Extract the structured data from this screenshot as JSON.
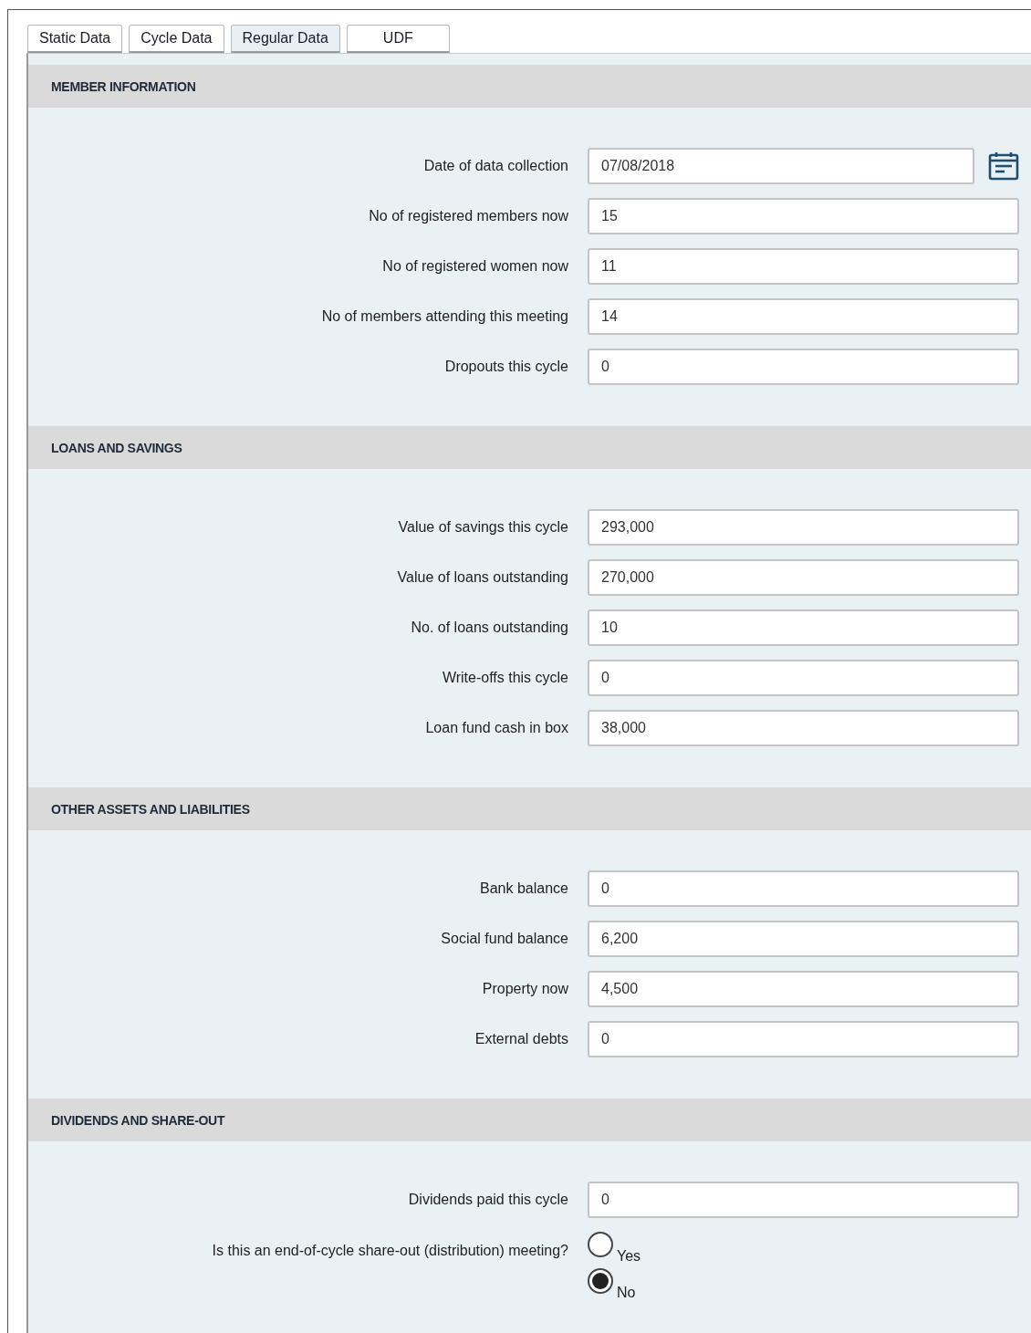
{
  "tabs": [
    {
      "label": "Static Data",
      "selected": false
    },
    {
      "label": "Cycle Data",
      "selected": false
    },
    {
      "label": "Regular Data",
      "selected": true
    },
    {
      "label": "UDF",
      "selected": false
    }
  ],
  "sections": [
    {
      "title": "MEMBER INFORMATION",
      "fields": [
        {
          "kind": "date",
          "label": "Date of data collection",
          "value": "07/08/2018"
        },
        {
          "kind": "text",
          "label": "No of registered members now",
          "value": "15"
        },
        {
          "kind": "text",
          "label": "No of registered women now",
          "value": "11"
        },
        {
          "kind": "text",
          "label": "No of members attending this meeting",
          "value": "14"
        },
        {
          "kind": "text",
          "label": "Dropouts this cycle",
          "value": "0"
        }
      ]
    },
    {
      "title": "LOANS AND SAVINGS",
      "fields": [
        {
          "kind": "text",
          "label": "Value of savings this cycle",
          "value": "293,000"
        },
        {
          "kind": "text",
          "label": "Value of loans outstanding",
          "value": "270,000"
        },
        {
          "kind": "text",
          "label": "No. of loans outstanding",
          "value": "10"
        },
        {
          "kind": "text",
          "label": "Write-offs this cycle",
          "value": "0"
        },
        {
          "kind": "text",
          "label": "Loan fund cash in box",
          "value": "38,000"
        }
      ]
    },
    {
      "title": "OTHER ASSETS AND LIABILITIES",
      "fields": [
        {
          "kind": "text",
          "label": "Bank balance",
          "value": "0"
        },
        {
          "kind": "text",
          "label": "Social fund balance",
          "value": "6,200"
        },
        {
          "kind": "text",
          "label": "Property now",
          "value": "4,500"
        },
        {
          "kind": "text",
          "label": "External debts",
          "value": "0"
        }
      ]
    },
    {
      "title": "DIVIDENDS AND SHARE-OUT",
      "fields": [
        {
          "kind": "text",
          "label": "Dividends paid this cycle",
          "value": "0"
        },
        {
          "kind": "radio",
          "label": "Is this an end-of-cycle share-out (distribution) meeting?",
          "options": [
            {
              "label": "Yes",
              "selected": false
            },
            {
              "label": "No",
              "selected": true
            }
          ]
        }
      ]
    }
  ]
}
